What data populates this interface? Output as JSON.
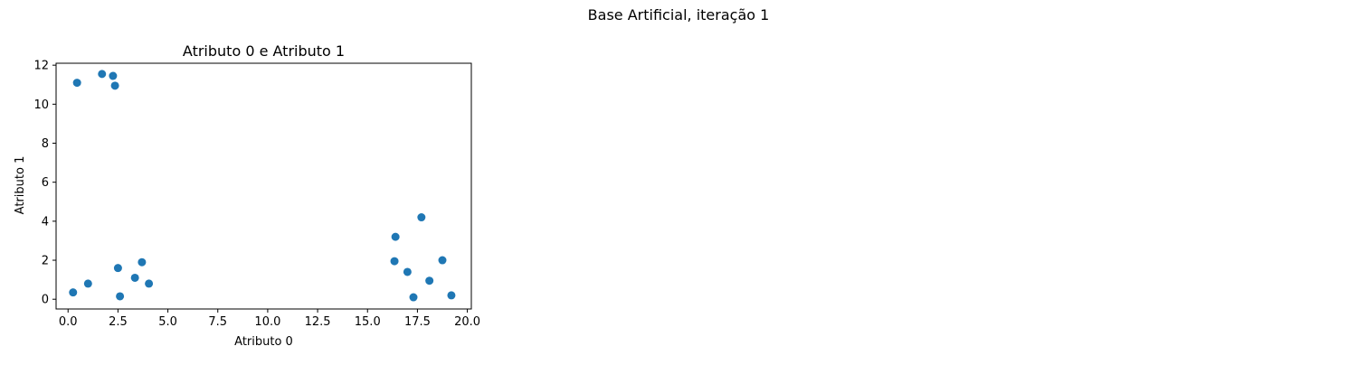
{
  "figure": {
    "suptitle": "Base Artificial, iteração 1"
  },
  "chart_data": {
    "type": "scatter",
    "title": "Atributo 0 e Atributo 1",
    "xlabel": "Atributo 0",
    "ylabel": "Atributo 1",
    "xlim": [
      -0.6,
      20.2
    ],
    "ylim": [
      -0.5,
      12.1
    ],
    "xticks": [
      0.0,
      2.5,
      5.0,
      7.5,
      10.0,
      12.5,
      15.0,
      17.5,
      20.0
    ],
    "xtick_labels": [
      "0.0",
      "2.5",
      "5.0",
      "7.5",
      "10.0",
      "12.5",
      "15.0",
      "17.5",
      "20.0"
    ],
    "yticks": [
      0,
      2,
      4,
      6,
      8,
      10,
      12
    ],
    "ytick_labels": [
      "0",
      "2",
      "4",
      "6",
      "8",
      "10",
      "12"
    ],
    "grid": false,
    "marker_color": "#1f77b4",
    "points": [
      {
        "x": 0.45,
        "y": 11.1
      },
      {
        "x": 1.7,
        "y": 11.55
      },
      {
        "x": 2.25,
        "y": 11.45
      },
      {
        "x": 2.35,
        "y": 10.95
      },
      {
        "x": 0.25,
        "y": 0.35
      },
      {
        "x": 1.0,
        "y": 0.8
      },
      {
        "x": 2.5,
        "y": 1.6
      },
      {
        "x": 2.6,
        "y": 0.15
      },
      {
        "x": 3.35,
        "y": 1.1
      },
      {
        "x": 3.7,
        "y": 1.9
      },
      {
        "x": 4.05,
        "y": 0.8
      },
      {
        "x": 16.4,
        "y": 3.2
      },
      {
        "x": 17.7,
        "y": 4.2
      },
      {
        "x": 16.35,
        "y": 1.95
      },
      {
        "x": 17.0,
        "y": 1.4
      },
      {
        "x": 18.75,
        "y": 2.0
      },
      {
        "x": 18.1,
        "y": 0.95
      },
      {
        "x": 17.3,
        "y": 0.1
      },
      {
        "x": 19.2,
        "y": 0.2
      }
    ]
  }
}
